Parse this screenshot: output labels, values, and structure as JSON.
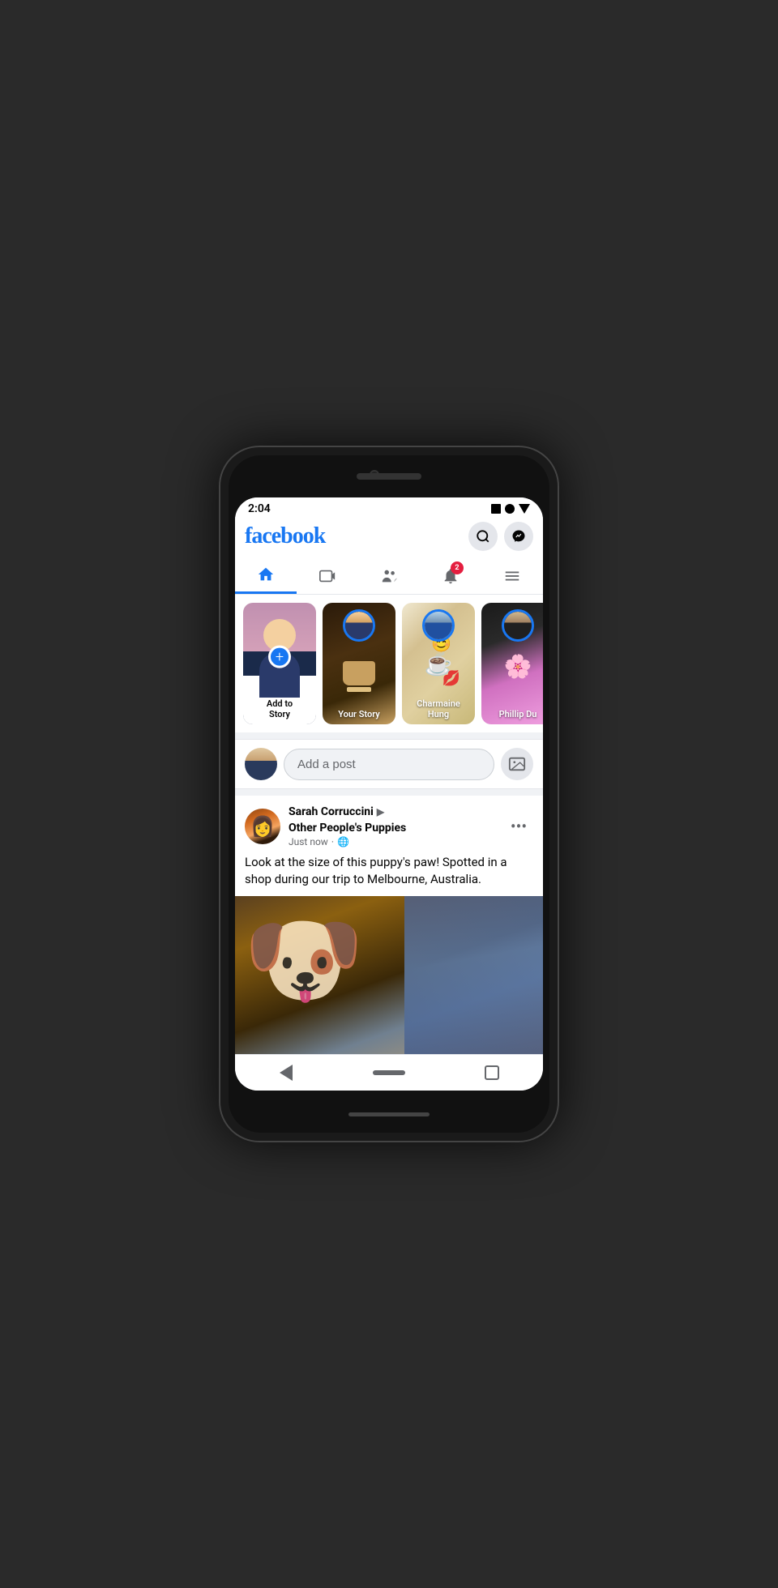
{
  "status_bar": {
    "time": "2:04",
    "icons": [
      "square",
      "circle",
      "triangle"
    ]
  },
  "header": {
    "logo": "facebook",
    "search_label": "search",
    "messenger_label": "messenger"
  },
  "nav_tabs": [
    {
      "id": "home",
      "label": "🏠",
      "active": true
    },
    {
      "id": "video",
      "label": "▶",
      "active": false
    },
    {
      "id": "groups",
      "label": "👥",
      "active": false
    },
    {
      "id": "notifications",
      "label": "🔔",
      "active": false,
      "badge": "2"
    },
    {
      "id": "menu",
      "label": "☰",
      "active": false
    }
  ],
  "stories": [
    {
      "id": "add",
      "label": "Add to\nStory",
      "type": "add"
    },
    {
      "id": "your",
      "label": "Your Story",
      "type": "your"
    },
    {
      "id": "charmaine",
      "label": "Charmaine Hung",
      "type": "person"
    },
    {
      "id": "phillip",
      "label": "Phillip Du",
      "type": "person"
    }
  ],
  "add_post": {
    "placeholder": "Add a post",
    "photo_label": "photo"
  },
  "post": {
    "user_name": "Sarah Corruccini",
    "arrow": "▶",
    "group_name": "Other People's Puppies",
    "time": "Just now",
    "privacy": "🌐",
    "more_options": "•••",
    "text": "Look at the size of this puppy's paw! Spotted in a shop during our trip to Melbourne, Australia."
  },
  "bottom_nav": {
    "back_label": "back",
    "home_label": "home pill",
    "square_label": "square"
  }
}
